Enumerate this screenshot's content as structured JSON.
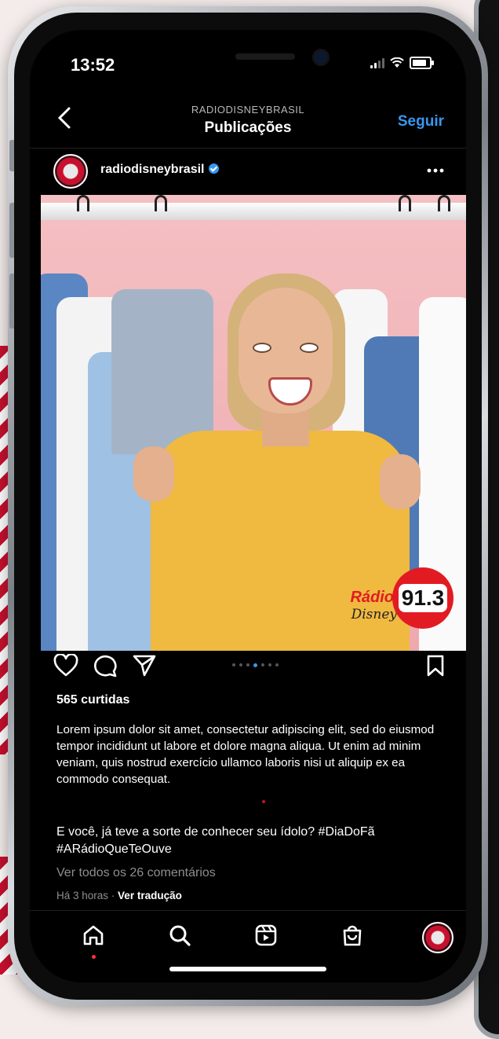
{
  "status_bar": {
    "time": "13:52"
  },
  "header": {
    "account": "RADIODISNEYBRASIL",
    "title": "Publicações",
    "follow_label": "Seguir"
  },
  "post": {
    "username": "radiodisneybrasil",
    "verified": true,
    "logo": {
      "radio": "Rádio",
      "disney": "Disney",
      "frequency": "91.3"
    },
    "carousel": {
      "total": 7,
      "active": 4
    },
    "likes": "565 curtidas",
    "body": "Lorem ipsum dolor sit amet, consectetur adipiscing elit, sed do eiusmod tempor incididunt ut labore et dolore magna aliqua. Ut enim ad minim veniam, quis nostrud exercício ullamco laboris nisi ut aliquip ex ea commodo consequat.",
    "caption": "E você, já teve a sorte de conhecer seu ídolo? #DiaDoFã #ARádioQueTeOuve",
    "view_comments": "Ver todos os 26 comentários",
    "time_ago": "Há 3 horas",
    "separator": " · ",
    "translate": "Ver tradução"
  },
  "icons": {
    "back": "chevron-left-icon",
    "more": "more-horizontal-icon",
    "like": "heart-icon",
    "comment": "comment-icon",
    "share": "send-icon",
    "save": "bookmark-icon",
    "tabs": [
      "home-icon",
      "search-icon",
      "reels-icon",
      "shop-icon",
      "profile-avatar"
    ]
  },
  "colors": {
    "accent": "#3897f0",
    "brand_red": "#e21b23",
    "background": "#000000"
  }
}
